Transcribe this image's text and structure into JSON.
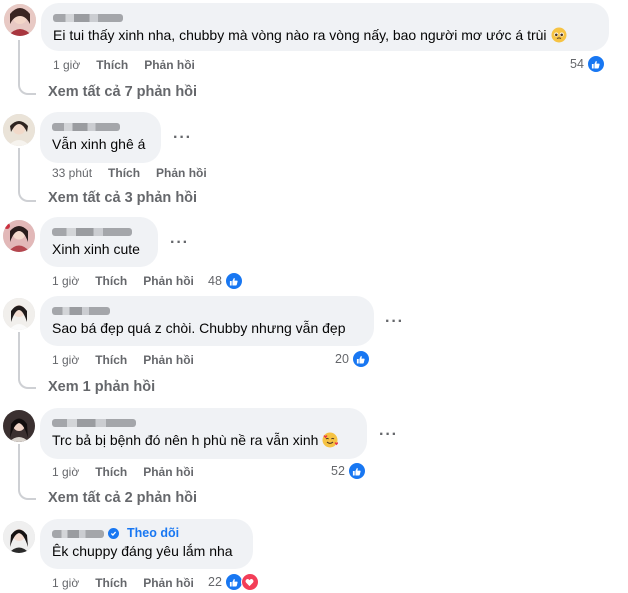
{
  "comments": [
    {
      "text": "Ei tui thấy xinh nha, chubby mà vòng nào ra vòng nấy, bao người mơ ước á trùi",
      "emoji": "pleading-face",
      "time": "1 giờ",
      "like_label": "Thích",
      "reply_label": "Phản hồi",
      "reaction_count": "54",
      "view_replies": "Xem tất cả 7 phản hồi"
    },
    {
      "text": "Vẫn xinh ghê á",
      "time": "33 phút",
      "like_label": "Thích",
      "reply_label": "Phản hồi",
      "view_replies": "Xem tất cả 3 phản hồi"
    },
    {
      "text": "Xinh xinh cute",
      "time": "1 giờ",
      "like_label": "Thích",
      "reply_label": "Phản hồi",
      "reaction_count": "48"
    },
    {
      "text": "Sao bá đẹp quá z chòi. Chubby nhưng vẫn đẹp",
      "time": "1 giờ",
      "like_label": "Thích",
      "reply_label": "Phản hồi",
      "reaction_count": "20",
      "view_replies": "Xem 1 phản hồi"
    },
    {
      "text": "Trc bả bị bệnh đó nên h phù nề ra vẫn xinh",
      "emoji": "smiling-face-with-hearts",
      "time": "1 giờ",
      "like_label": "Thích",
      "reply_label": "Phản hồi",
      "reaction_count": "52",
      "view_replies": "Xem tất cả 2 phản hồi"
    },
    {
      "text": "Êk chuppy đáng yêu lắm nha",
      "follow_label": "Theo dõi",
      "time": "1 giờ",
      "like_label": "Thích",
      "reply_label": "Phản hồi",
      "reaction_count": "22"
    }
  ],
  "more_label": "···",
  "colors": {
    "bubble": "#f0f2f5",
    "muted": "#65676b",
    "link": "#1877f2",
    "like": "#1877f2",
    "love": "#f33e58"
  }
}
